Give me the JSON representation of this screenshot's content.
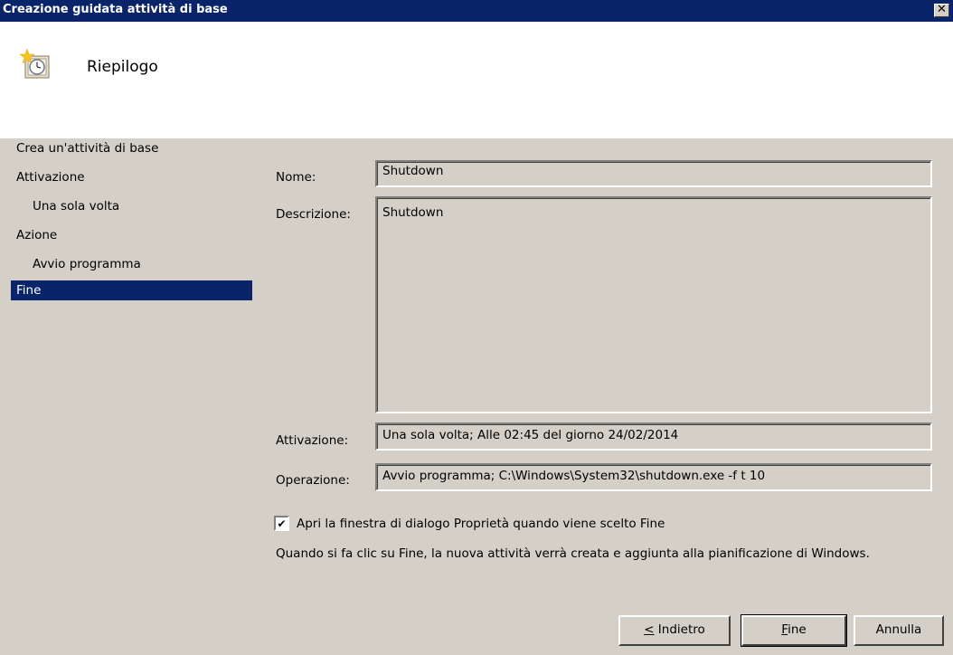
{
  "window": {
    "title": "Creazione guidata attività di base",
    "close_glyph": "✕"
  },
  "header": {
    "heading": "Riepilogo",
    "icon": "task-clock-icon"
  },
  "steps": [
    {
      "label": "Crea un'attività di base",
      "sub": false,
      "active": false
    },
    {
      "label": "Attivazione",
      "sub": false,
      "active": false
    },
    {
      "label": "Una sola volta",
      "sub": true,
      "active": false
    },
    {
      "label": "Azione",
      "sub": false,
      "active": false
    },
    {
      "label": "Avvio programma",
      "sub": true,
      "active": false
    },
    {
      "label": "Fine",
      "sub": false,
      "active": true
    }
  ],
  "summary": {
    "name_label": "Nome:",
    "name_value": "Shutdown",
    "description_label": "Descrizione:",
    "description_value": "Shutdown",
    "trigger_label": "Attivazione:",
    "trigger_value": "Una sola volta; Alle 02:45 del giorno 24/02/2014",
    "action_label": "Operazione:",
    "action_value": "Avvio programma; C:\\Windows\\System32\\shutdown.exe -f t 10"
  },
  "checkbox": {
    "label": "Apri la finestra di dialogo Proprietà quando viene scelto Fine",
    "checked": true,
    "glyph": "✔"
  },
  "info_text": "Quando si fa clic su Fine, la nuova attività verrà creata e aggiunta alla pianificazione di Windows.",
  "buttons": {
    "back_prefix": "<",
    "back_label": " Indietro",
    "finish_first": "F",
    "finish_rest": "ine",
    "cancel": "Annulla"
  },
  "colors": {
    "titlebar": "#0a246a",
    "selection": "#0a246a",
    "face": "#d4d0c8"
  }
}
